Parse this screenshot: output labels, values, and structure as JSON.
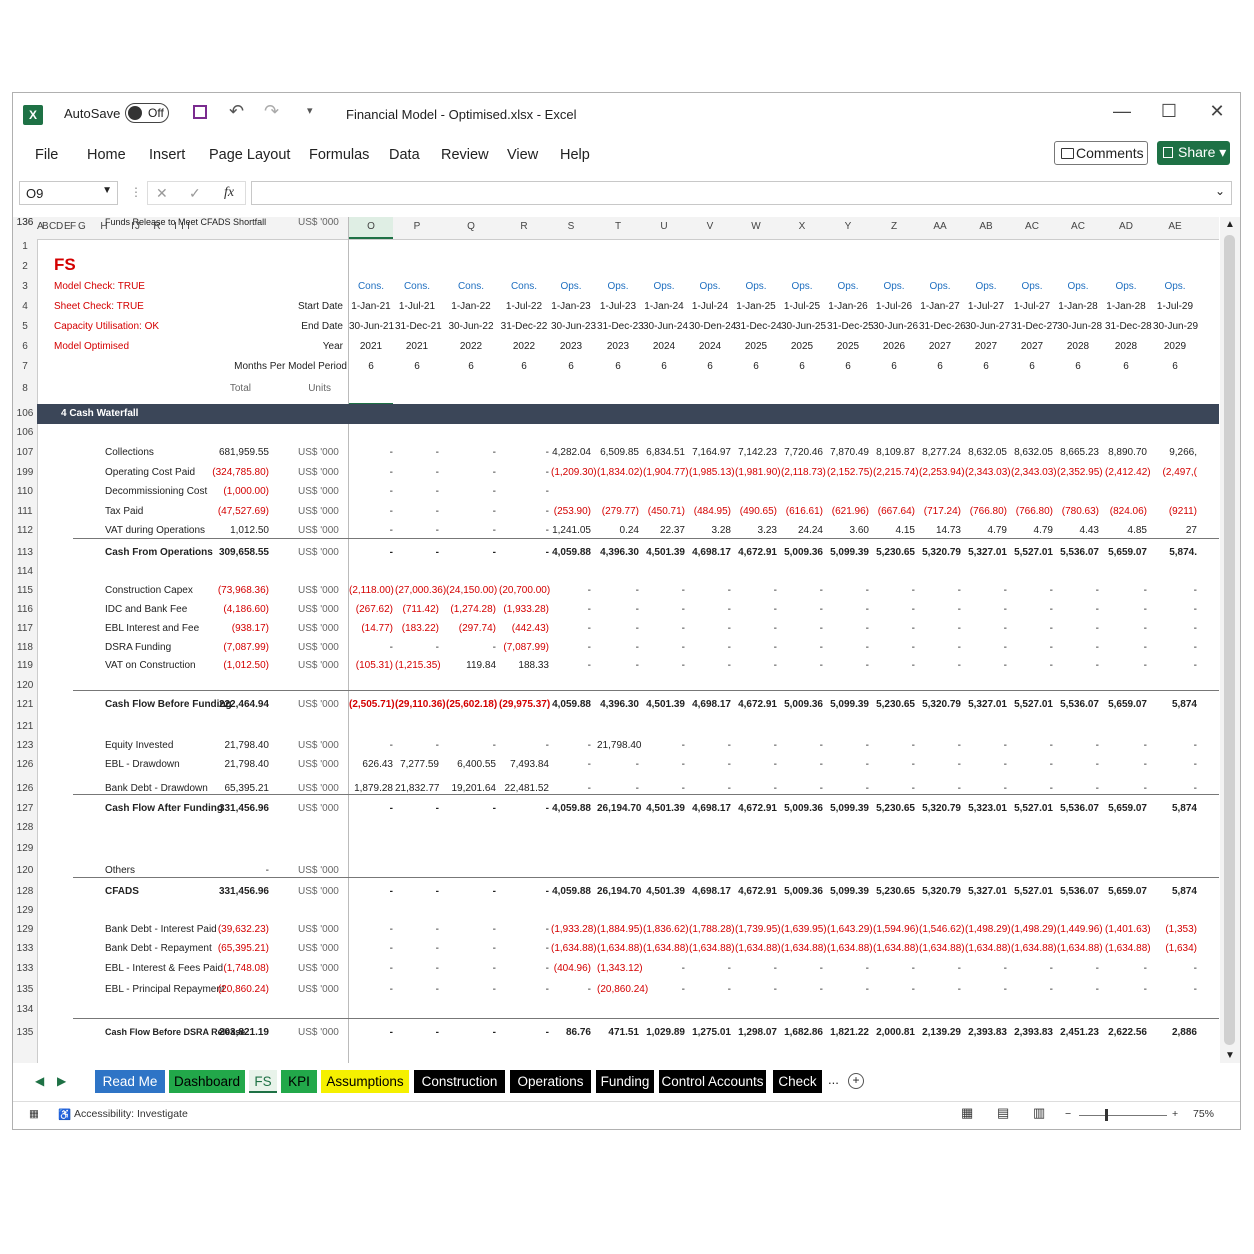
{
  "titlebar": {
    "app_icon": "X",
    "autosave_label": "AutoSave",
    "autosave_state": "Off",
    "title": "Financial Model - Optimised.xlsx  -  Excel"
  },
  "menu": [
    "File",
    "Home",
    "Insert",
    "Page Layout",
    "Formulas",
    "Data",
    "Review",
    "View",
    "Help"
  ],
  "comments_label": "Comments",
  "share_label": "Share",
  "formula_bar": {
    "name_box": "O9",
    "fx": "fx",
    "content": ""
  },
  "columns": [
    "A",
    "B",
    "C",
    "D",
    "E",
    "F",
    "G",
    "H",
    "I",
    "J",
    "R",
    "I",
    "I",
    "I",
    "O",
    "P",
    "Q",
    "R",
    "S",
    "T",
    "U",
    "V",
    "W",
    "X",
    "Y",
    "Z",
    "AA",
    "AB",
    "AC",
    "AC",
    "AD",
    "AE"
  ],
  "header": {
    "fs_title": "FS",
    "checks": [
      "Model Check: TRUE",
      "Sheet Check: TRUE",
      "Capacity Utilisation: OK",
      "Model Optimised"
    ],
    "labels": {
      "start": "Start Date",
      "end": "End Date",
      "year": "Year",
      "months": "Months Per Model Period",
      "total": "Total",
      "units": "Units"
    },
    "phase": [
      "Cons.",
      "Cons.",
      "Cons.",
      "Cons.",
      "Ops.",
      "Ops.",
      "Ops.",
      "Ops.",
      "Ops.",
      "Ops.",
      "Ops.",
      "Ops.",
      "Ops.",
      "Ops.",
      "Ops.",
      "Ops.",
      "Ops.",
      "Ops."
    ],
    "start": [
      "1-Jan-21",
      "1-Jul-21",
      "1-Jan-22",
      "1-Jul-22",
      "1-Jan-23",
      "1-Jul-23",
      "1-Jan-24",
      "1-Jul-24",
      "1-Jan-25",
      "1-Jul-25",
      "1-Jan-26",
      "1-Jul-26",
      "1-Jan-27",
      "1-Jul-27",
      "1-Jul-27",
      "1-Jan-28",
      "1-Jan-28",
      "1-Jul-29"
    ],
    "end": [
      "30-Jun-21",
      "31-Dec-21",
      "30-Jun-22",
      "31-Dec-22",
      "30-Jun-23",
      "31-Dec-23",
      "30-Jun-24",
      "30-Den-24",
      "31-Dec-24",
      "30-Jun-25",
      "31-Dec-25",
      "30-Jun-26",
      "31-Dec-26",
      "30-Jun-27",
      "31-Dec-27",
      "30-Jun-28",
      "31-Dec-28",
      "30-Jun-29"
    ],
    "year": [
      "2021",
      "2021",
      "2022",
      "2022",
      "2023",
      "2023",
      "2024",
      "2024",
      "2025",
      "2025",
      "2025",
      "2026",
      "2027",
      "2027",
      "2027",
      "2028",
      "2028",
      "2029"
    ],
    "months": [
      "6",
      "6",
      "6",
      "6",
      "6",
      "6",
      "6",
      "6",
      "6",
      "6",
      "6",
      "6",
      "6",
      "6",
      "6",
      "6",
      "6",
      "6"
    ]
  },
  "header_rows": [
    "1",
    "2",
    "3",
    "4",
    "5",
    "6",
    "7",
    "8"
  ],
  "section": {
    "row": "106",
    "title": "4  Cash Waterfall"
  },
  "rows": [
    {
      "row": "106",
      "label": "",
      "total": "",
      "units": "",
      "vals": []
    },
    {
      "row": "107",
      "label": "Collections",
      "total": "681,959.55",
      "units": "US$ '000",
      "vals": [
        "-",
        "-",
        "-",
        "-",
        "4,282.04",
        "6,509.85",
        "6,834.51",
        "7,164.97",
        "7,142.23",
        "7,720.46",
        "7,870.49",
        "8,109.87",
        "8,277.24",
        "8,632.05",
        "8,632.05",
        "8,665.23",
        "8,890.70",
        "9,266,"
      ]
    },
    {
      "row": "199",
      "label": "Operating Cost Paid",
      "total": "(324,785.80)",
      "units": "US$ '000",
      "red": true,
      "vals": [
        "-",
        "-",
        "-",
        "-",
        "(1,209.30)",
        "(1,834.02)",
        "(1,904.77)",
        "(1,985.13)",
        "(1,981.90)",
        "(2,118.73)",
        "(2,152.75)",
        "(2,215.74)",
        "(2,253.94)",
        "(2,343.03)",
        "(2,343.03)",
        "(2,352.95)",
        "(2,412.42)",
        "(2,497,("
      ]
    },
    {
      "row": "110",
      "label": "Decommissioning Cost",
      "total": "(1,000.00)",
      "units": "US$ '000",
      "red": true,
      "vals": [
        "-",
        "-",
        "-",
        "-"
      ]
    },
    {
      "row": "111",
      "label": "Tax Paid",
      "total": "(47,527.69)",
      "units": "US$ '000",
      "red": true,
      "vals": [
        "-",
        "-",
        "-",
        "-",
        "(253.90)",
        "(279.77)",
        "(450.71)",
        "(484.95)",
        "(490.65)",
        "(616.61)",
        "(621.96)",
        "(667.64)",
        "(717.24)",
        "(766.80)",
        "(766.80)",
        "(780.63)",
        "(824.06)",
        "(9211)"
      ]
    },
    {
      "row": "112",
      "label": "VAT during Operations",
      "total": "1,012.50",
      "units": "US$ '000",
      "vals": [
        "-",
        "-",
        "-",
        "-",
        "1,241.05",
        "0.24",
        "22.37",
        "3.28",
        "3.23",
        "24.24",
        "3.60",
        "4.15",
        "14.73",
        "4.79",
        "4.79",
        "4.43",
        "4.85",
        "27"
      ]
    },
    {
      "row": "113",
      "label": "Cash From Operations",
      "total": "309,658.55",
      "units": "US$ '000",
      "bold": true,
      "line": true,
      "vals": [
        "-",
        "-",
        "-",
        "-",
        "4,059.88",
        "4,396.30",
        "4,501.39",
        "4,698.17",
        "4,672.91",
        "5,009.36",
        "5,099.39",
        "5,230.65",
        "5,320.79",
        "5,327.01",
        "5,527.01",
        "5,536.07",
        "5,659.07",
        "5,874."
      ]
    },
    {
      "row": "114",
      "label": "",
      "total": "",
      "units": "",
      "vals": []
    },
    {
      "row": "115",
      "label": "Construction Capex",
      "total": "(73,968.36)",
      "units": "US$ '000",
      "red": true,
      "vals": [
        "(2,118.00)",
        "(27,000.36)",
        "(24,150.00)",
        "(20,700.00)",
        "-",
        "-",
        "-",
        "-",
        "-",
        "-",
        "-",
        "-",
        "-",
        "-",
        "-",
        "-",
        "-",
        "-"
      ]
    },
    {
      "row": "116",
      "label": "IDC and Bank Fee",
      "total": "(4,186.60)",
      "units": "US$ '000",
      "red": true,
      "vals": [
        "(267.62)",
        "(711.42)",
        "(1,274.28)",
        "(1,933.28)",
        "-",
        "-",
        "-",
        "-",
        "-",
        "-",
        "-",
        "-",
        "-",
        "-",
        "-",
        "-",
        "-",
        "-"
      ]
    },
    {
      "row": "117",
      "label": "EBL Interest and Fee",
      "total": "(938.17)",
      "units": "US$ '000",
      "red": true,
      "vals": [
        "(14.77)",
        "(183.22)",
        "(297.74)",
        "(442.43)",
        "-",
        "-",
        "-",
        "-",
        "-",
        "-",
        "-",
        "-",
        "-",
        "-",
        "-",
        "-",
        "-",
        "-"
      ]
    },
    {
      "row": "118",
      "label": "DSRA Funding",
      "total": "(7,087.99)",
      "units": "US$ '000",
      "red": true,
      "vals": [
        "-",
        "-",
        "-",
        "(7,087.99)",
        "-",
        "-",
        "-",
        "-",
        "-",
        "-",
        "-",
        "-",
        "-",
        "-",
        "-",
        "-",
        "-",
        "-"
      ]
    },
    {
      "row": "119",
      "label": "VAT on Construction",
      "total": "(1,012.50)",
      "units": "US$ '000",
      "red": true,
      "vals": [
        "(105.31)",
        "(1,215.35)",
        "119.84",
        "188.33",
        "-",
        "-",
        "-",
        "-",
        "-",
        "-",
        "-",
        "-",
        "-",
        "-",
        "-",
        "-",
        "-",
        "-"
      ]
    },
    {
      "row": "120",
      "label": "",
      "total": "",
      "units": "",
      "vals": []
    },
    {
      "row": "121",
      "label": "Cash Flow Before Funding",
      "total": "222,464.94",
      "units": "US$ '000",
      "bold": true,
      "line": true,
      "vals": [
        "(2,505.71)",
        "(29,110.36)",
        "(25,602.18)",
        "(29,975.37)",
        "4,059.88",
        "4,396.30",
        "4,501.39",
        "4,698.17",
        "4,672.91",
        "5,009.36",
        "5,099.39",
        "5,230.65",
        "5,320.79",
        "5,327.01",
        "5,527.01",
        "5,536.07",
        "5,659.07",
        "5,874"
      ]
    },
    {
      "row": "121",
      "label": "",
      "total": "",
      "units": "",
      "vals": []
    },
    {
      "row": "123",
      "label": "Equity Invested",
      "total": "21,798.40",
      "units": "US$ '000",
      "vals": [
        "-",
        "-",
        "-",
        "-",
        "-",
        "21,798.40",
        "-",
        "-",
        "-",
        "-",
        "-",
        "-",
        "-",
        "-",
        "-",
        "-",
        "-",
        "-"
      ]
    },
    {
      "row": "126",
      "label": "EBL - Drawdown",
      "total": "21,798.40",
      "units": "US$ '000",
      "vals": [
        "626.43",
        "7,277.59",
        "6,400.55",
        "7,493.84",
        "-",
        "-",
        "-",
        "-",
        "-",
        "-",
        "-",
        "-",
        "-",
        "-",
        "-",
        "-",
        "-",
        "-"
      ]
    },
    {
      "row": "126",
      "label": "Bank Debt - Drawdown",
      "total": "65,395.21",
      "units": "US$ '000",
      "vals": [
        "1,879.28",
        "21,832.77",
        "19,201.64",
        "22,481.52",
        "-",
        "-",
        "-",
        "-",
        "-",
        "-",
        "-",
        "-",
        "-",
        "-",
        "-",
        "-",
        "-",
        "-"
      ]
    },
    {
      "row": "127",
      "label": "Cash Flow After Funding",
      "total": "331,456.96",
      "units": "US$ '000",
      "bold": true,
      "line": true,
      "vals": [
        "-",
        "-",
        "-",
        "-",
        "4,059.88",
        "26,194.70",
        "4,501.39",
        "4,698.17",
        "4,672.91",
        "5,009.36",
        "5,099.39",
        "5,230.65",
        "5,320.79",
        "5,323.01",
        "5,527.01",
        "5,536.07",
        "5,659.07",
        "5,874"
      ]
    },
    {
      "row": "128",
      "label": "",
      "total": "",
      "units": "",
      "vals": []
    },
    {
      "row": "129",
      "label": "",
      "total": "",
      "units": "",
      "vals": []
    },
    {
      "row": "120",
      "label": "Others",
      "total": "-",
      "units": "US$ '000",
      "vals": []
    },
    {
      "row": "128",
      "label": "CFADS",
      "total": "331,456.96",
      "units": "US$ '000",
      "bold": true,
      "line": true,
      "vals": [
        "-",
        "-",
        "-",
        "-",
        "4,059.88",
        "26,194.70",
        "4,501.39",
        "4,698.17",
        "4,672.91",
        "5,009.36",
        "5,099.39",
        "5,230.65",
        "5,320.79",
        "5,327.01",
        "5,527.01",
        "5,536.07",
        "5,659.07",
        "5,874"
      ]
    },
    {
      "row": "129",
      "label": "",
      "total": "",
      "units": "",
      "vals": []
    },
    {
      "row": "129",
      "label": "Bank Debt - Interest Paid",
      "total": "(39,632.23)",
      "units": "US$ '000",
      "red": true,
      "vals": [
        "-",
        "-",
        "-",
        "-",
        "(1,933.28)",
        "(1,884.95)",
        "(1,836.62)",
        "(1,788.28)",
        "(1,739.95)",
        "(1,639.95)",
        "(1,643.29)",
        "(1,594.96)",
        "(1,546.62)",
        "(1,498.29)",
        "(1,498.29)",
        "(1,449.96)",
        "(1,401.63)",
        "(1,353)"
      ]
    },
    {
      "row": "133",
      "label": "Bank Debt - Repayment",
      "total": "(65,395.21)",
      "units": "US$ '000",
      "red": true,
      "vals": [
        "-",
        "-",
        "-",
        "-",
        "(1,634.88)",
        "(1,634.88)",
        "(1,634.88)",
        "(1,634.88)",
        "(1,634.88)",
        "(1,634.88)",
        "(1,634.88)",
        "(1,634.88)",
        "(1,634.88)",
        "(1,634.88)",
        "(1,634.88)",
        "(1,634.88)",
        "(1,634.88)",
        "(1,634)"
      ]
    },
    {
      "row": "133",
      "label": "EBL - Interest & Fees Paid",
      "total": "(1,748.08)",
      "units": "US$ '000",
      "red": true,
      "vals": [
        "-",
        "-",
        "-",
        "-",
        "(404.96)",
        "(1,343.12)",
        "-",
        "-",
        "-",
        "-",
        "-",
        "-",
        "-",
        "-",
        "-",
        "-",
        "-",
        "-"
      ]
    },
    {
      "row": "135",
      "label": "EBL - Principal Repayment",
      "total": "(20,860.24)",
      "units": "US$ '000",
      "red": true,
      "vals": [
        "-",
        "-",
        "-",
        "-",
        "-",
        "(20,860.24)",
        "-",
        "-",
        "-",
        "-",
        "-",
        "-",
        "-",
        "-",
        "-",
        "-",
        "-",
        "-"
      ]
    },
    {
      "row": "134",
      "label": "",
      "total": "",
      "units": "",
      "vals": []
    },
    {
      "row": "135",
      "label": "Cash Flow Before DSRA Release",
      "total": "203,821.19",
      "units": "US$ '000",
      "bold": true,
      "line": true,
      "vals": [
        "-",
        "-",
        "-",
        "-",
        "86.76",
        "471.51",
        "1,029.89",
        "1,275.01",
        "1,298.07",
        "1,682.86",
        "1,821.22",
        "2,000.81",
        "2,139.29",
        "2,393.83",
        "2,393.83",
        "2,451.23",
        "2,622.56",
        "2,886"
      ]
    },
    {
      "row": "136",
      "label": "",
      "total": "",
      "units": "",
      "vals": []
    },
    {
      "row": "136",
      "label": "Funds Release to Meet CFADS Shortfall",
      "total": "",
      "units": "US$ '000",
      "vals": []
    }
  ],
  "tabs": [
    {
      "label": "Read Me",
      "bg": "#2e74c6",
      "fg": "#ffffff"
    },
    {
      "label": "Dashboard",
      "bg": "#22a84a",
      "fg": "#000000"
    },
    {
      "label": "FS",
      "bg": "#e8f3ea",
      "fg": "#1e7145"
    },
    {
      "label": "KPI",
      "bg": "#22a84a",
      "fg": "#000000"
    },
    {
      "label": "Assumptions",
      "bg": "#f5f000",
      "fg": "#000000"
    },
    {
      "label": "Construction",
      "bg": "#000000",
      "fg": "#ffffff"
    },
    {
      "label": "Operations",
      "bg": "#000000",
      "fg": "#ffffff"
    },
    {
      "label": "Funding",
      "bg": "#000000",
      "fg": "#ffffff"
    },
    {
      "label": "Control Accounts",
      "bg": "#000000",
      "fg": "#ffffff"
    },
    {
      "label": "Check",
      "bg": "#000000",
      "fg": "#ffffff"
    }
  ],
  "tabs_more": "...",
  "add_sheet": "+",
  "status": {
    "accessibility": "Accessibility: Investigate",
    "zoom": "75%"
  },
  "colors": {
    "accent": "#1e7145",
    "section_band": "#3b4658",
    "negative": "#d40000",
    "phase_text": "#1f6fc0"
  }
}
